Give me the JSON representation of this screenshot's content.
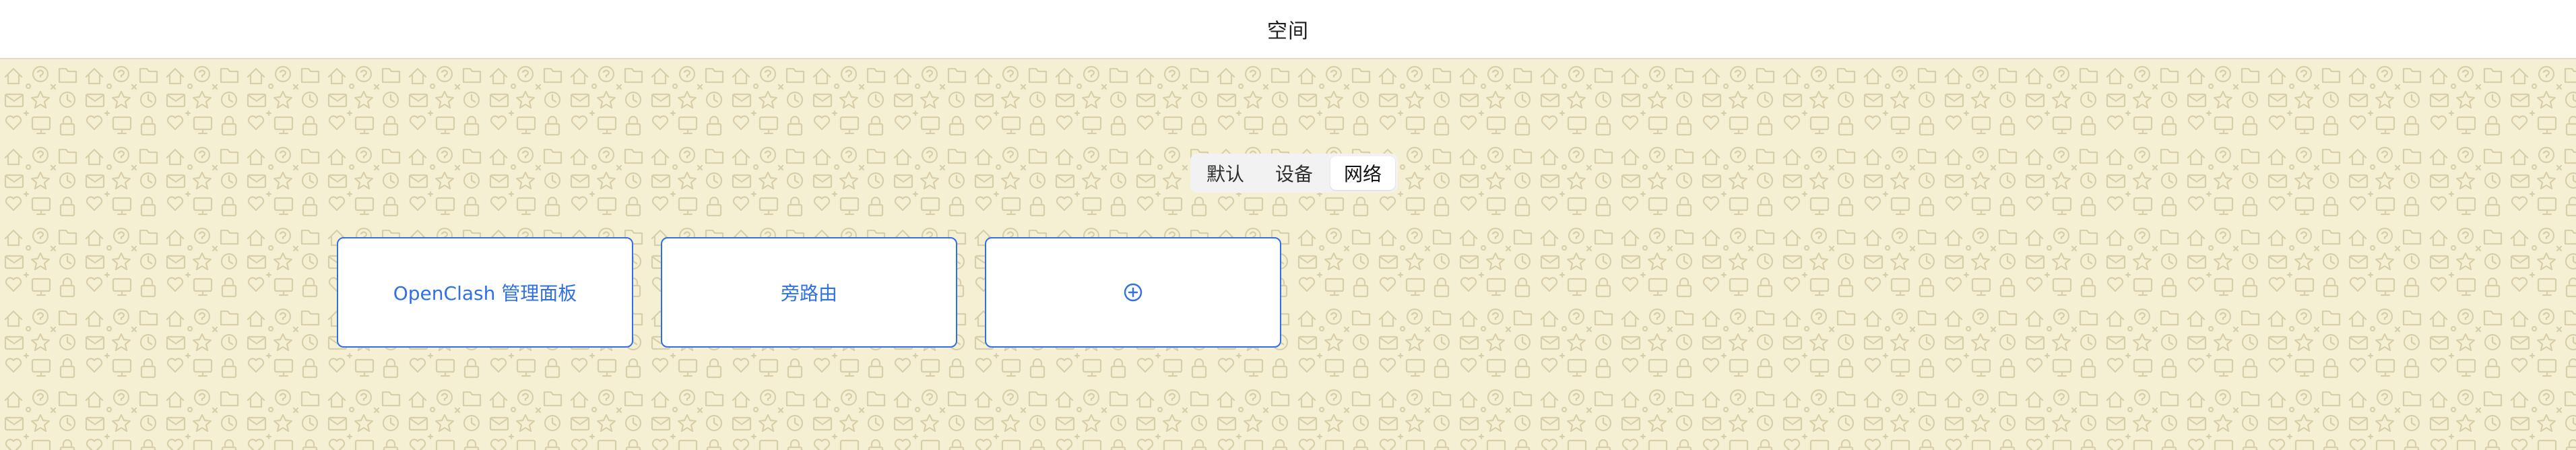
{
  "header": {
    "title": "空间"
  },
  "tabs": [
    {
      "label": "默认",
      "active": false
    },
    {
      "label": "设备",
      "active": false
    },
    {
      "label": "网络",
      "active": true
    }
  ],
  "cards": [
    {
      "label": "OpenClash 管理面板"
    },
    {
      "label": "旁路由"
    }
  ],
  "add_card": {
    "icon": "plus-circle-icon"
  },
  "colors": {
    "background": "#f5efd3",
    "pattern": "#d8ceaa",
    "accent": "#2f6fe8",
    "header_bg": "#ffffff"
  }
}
